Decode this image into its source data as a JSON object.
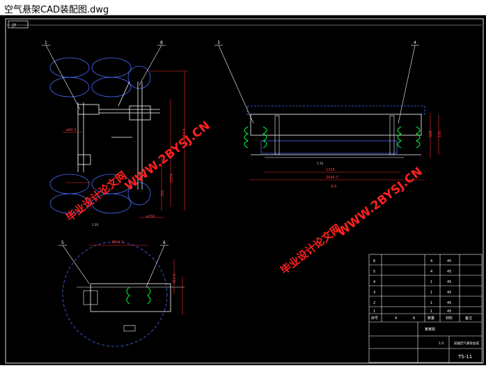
{
  "window": {
    "title": "空气悬架CAD装配图.dwg"
  },
  "drawing": {
    "corner_code": "JY",
    "watermark_url": "WWW.2BYSJ.CN",
    "watermark_cn": "毕业设计论文网",
    "balloons": [
      "1",
      "8",
      "3",
      "4",
      "5",
      "6"
    ],
    "section_label": "A-A",
    "titleblock": {
      "drawing_no": "TS-11",
      "title": "前轴空气悬架总成",
      "company": "某某院",
      "scale_label": "1:5",
      "material_rows": [
        {
          "no": "6",
          "qty": "4",
          "mat": "45"
        },
        {
          "no": "5",
          "qty": "4",
          "mat": "45"
        },
        {
          "no": "4",
          "qty": "1",
          "mat": "45"
        },
        {
          "no": "3",
          "qty": "1",
          "mat": "45"
        },
        {
          "no": "2",
          "qty": "1",
          "mat": "45"
        },
        {
          "no": "1",
          "qty": "1",
          "mat": "45"
        }
      ],
      "header": {
        "no": "序号",
        "code": "4",
        "name": "6",
        "qty": "数量",
        "mat": "材料",
        "note": "备注"
      }
    },
    "dims": {
      "top_width": "1318",
      "top_width2": "2094.3",
      "top_height": "588",
      "top_h2": "131",
      "side_width": "3811.3",
      "side_h": "312.5"
    }
  }
}
